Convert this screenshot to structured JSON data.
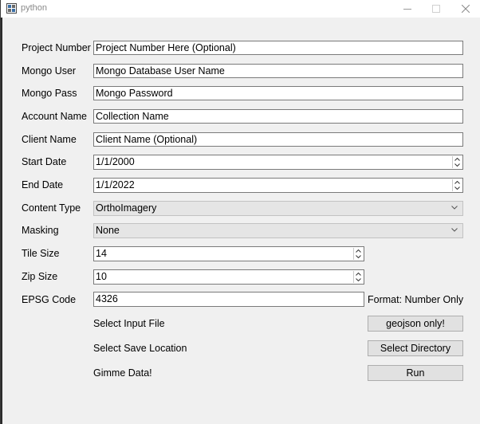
{
  "window": {
    "title": "python",
    "icon": "python-app-icon",
    "controls": {
      "minimize": "minimize-icon",
      "maximize": "maximize-icon",
      "close": "close-icon"
    }
  },
  "form": {
    "project_number": {
      "label": "Project Number",
      "value": "Project Number Here (Optional)"
    },
    "mongo_user": {
      "label": "Mongo User",
      "value": "Mongo Database User Name"
    },
    "mongo_pass": {
      "label": "Mongo Pass",
      "value": "Mongo Password"
    },
    "account_name": {
      "label": "Account Name",
      "value": "Collection Name"
    },
    "client_name": {
      "label": "Client Name",
      "value": "Client Name (Optional)"
    },
    "start_date": {
      "label": "Start Date",
      "value": "1/1/2000"
    },
    "end_date": {
      "label": "End Date",
      "value": "1/1/2022"
    },
    "content_type": {
      "label": "Content Type",
      "value": "OrthoImagery"
    },
    "masking": {
      "label": "Masking",
      "value": "None"
    },
    "tile_size": {
      "label": "Tile Size",
      "value": "14"
    },
    "zip_size": {
      "label": "Zip Size",
      "value": "10"
    },
    "epsg_code": {
      "label": "EPSG Code",
      "value": "4326",
      "hint": "Format: Number Only"
    }
  },
  "actions": {
    "input_file": {
      "label": "Select Input File",
      "button": "geojson only!"
    },
    "save_location": {
      "label": "Select Save Location",
      "button": "Select Directory"
    },
    "run": {
      "label": "Gimme Data!",
      "button": "Run"
    }
  }
}
